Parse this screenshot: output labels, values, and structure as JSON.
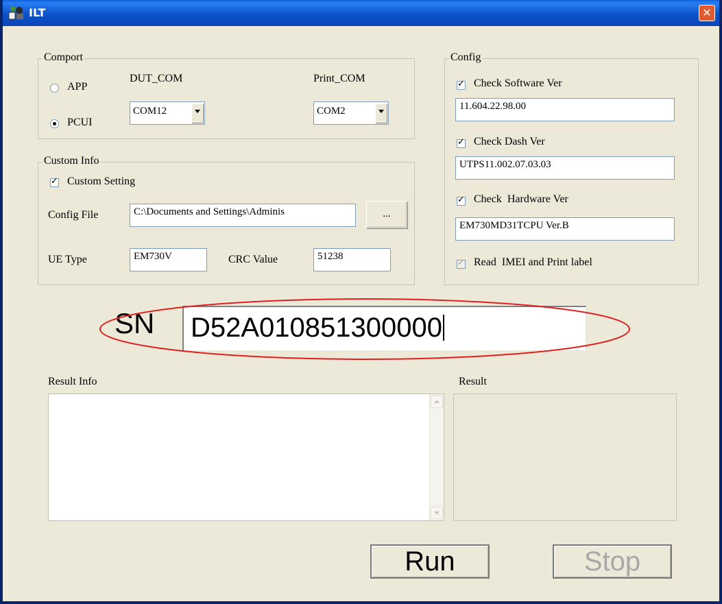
{
  "window": {
    "title": "ILT",
    "app_icon": "app-logo-icon",
    "close_icon": "close-icon",
    "close_glyph": "✕"
  },
  "comport": {
    "title": "Comport",
    "dut_label": "DUT_COM",
    "print_label": "Print_COM",
    "radio_app": {
      "label": "APP",
      "checked": false
    },
    "radio_pcui": {
      "label": "PCUI",
      "checked": true
    },
    "dut_com_value": "COM12",
    "print_com_value": "COM2"
  },
  "custom_info": {
    "title": "Custom Info",
    "custom_setting": {
      "label": "Custom Setting",
      "checked": true
    },
    "config_file_label": "Config File",
    "config_file_value": "C:\\Documents and Settings\\Adminis",
    "browse_label": "...",
    "ue_type_label": "UE Type",
    "ue_type_value": "EM730V",
    "crc_label": "CRC Value",
    "crc_value": "51238"
  },
  "config": {
    "title": "Config",
    "check_software": {
      "label": "Check Software Ver",
      "checked": true,
      "value": "11.604.22.98.00"
    },
    "check_dash": {
      "label": "Check Dash Ver",
      "checked": true,
      "value": "UTPS11.002.07.03.03"
    },
    "check_hardware": {
      "label": "Check  Hardware Ver",
      "checked": true,
      "value": "EM730MD31TCPU Ver.B"
    },
    "read_imei": {
      "label": "Read  IMEI and Print label",
      "checked": true,
      "disabled": true
    }
  },
  "sn": {
    "label": "SN",
    "value": "D52A010851300000"
  },
  "result_info": {
    "label": "Result Info"
  },
  "result": {
    "label": "Result"
  },
  "buttons": {
    "run": "Run",
    "stop": "Stop"
  },
  "colors": {
    "annotation_ellipse": "#e02020",
    "titlebar": "#0a52c9",
    "window_bg": "#ece9d8"
  }
}
